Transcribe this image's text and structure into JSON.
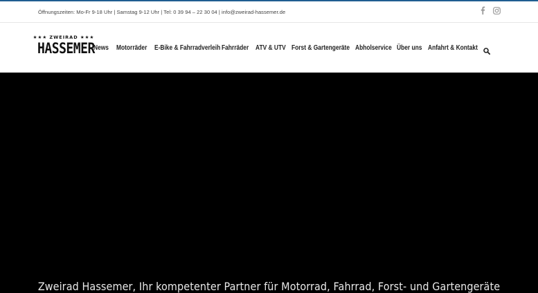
{
  "topbar": {
    "info": "Öffnungszeiten: Mo-Fr 9-18 Uhr | Samstag 9-12 Uhr | Tel: 0 39 94 – 22 30 04  |  info@zweirad-hassemer.de",
    "social": [
      "facebook-icon",
      "instagram-icon"
    ]
  },
  "logo": {
    "top": "★★★ ZWEIRAD ★★★",
    "main": "HASSEMER"
  },
  "nav": {
    "items": [
      {
        "label": "News"
      },
      {
        "label": "Motorräder"
      },
      {
        "label": "E-Bike & Fahrradverleih"
      },
      {
        "label": "Fahrräder"
      },
      {
        "label": "ATV & UTV"
      },
      {
        "label": "Forst & Gartengeräte"
      },
      {
        "label": "Abholservice"
      },
      {
        "label": "Über uns"
      },
      {
        "label": "Anfahrt & Kontakt"
      }
    ],
    "search_icon": "search-icon"
  },
  "hero": {
    "title": "Zweirad Hassemer, Ihr kompetenter Partner für Motorrad, Fahrrad, Forst- und Gartengeräte"
  },
  "colors": {
    "accent": "#1f5d91",
    "nav_text": "#222222",
    "hero_bg": "#000000"
  }
}
